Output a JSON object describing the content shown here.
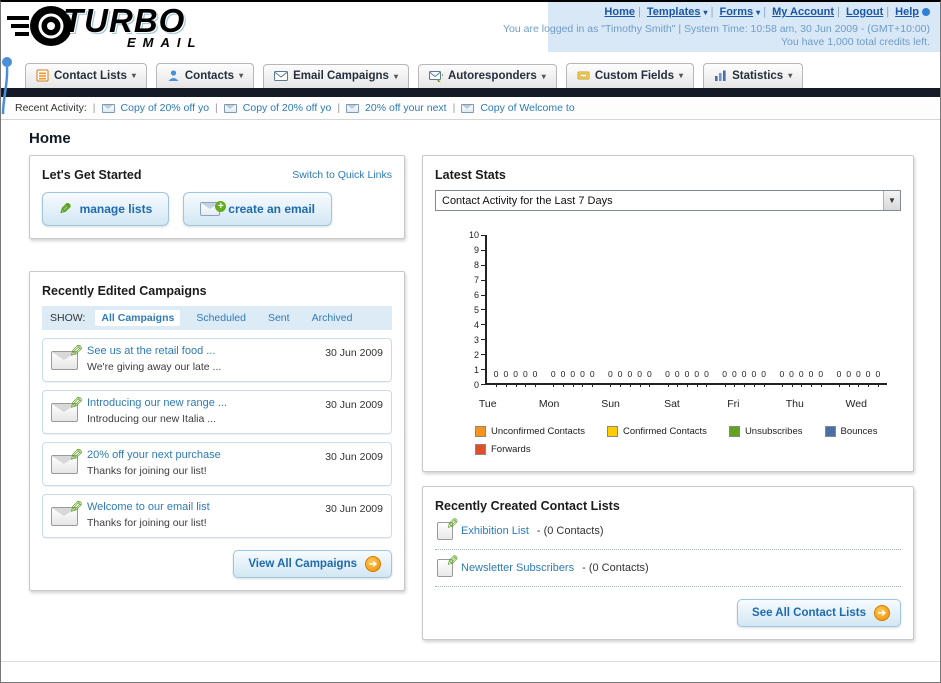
{
  "colors": {
    "link_blue": "#1a56a8",
    "dark_bar": "#141b27",
    "accent_orange": "#f29005",
    "button_text": "#1e6bb0"
  },
  "header": {
    "logo_top": "TURBO",
    "logo_bottom": "EMAIL",
    "nav_links": [
      {
        "label": "Home"
      },
      {
        "label": "Templates"
      },
      {
        "label": "Forms"
      },
      {
        "label": "My Account"
      },
      {
        "label": "Logout"
      },
      {
        "label": "Help"
      }
    ],
    "login_info": "You are logged in as \"Timothy Smith\" | System Time: 10:58 am, 30 Jun 2009 - (GMT+10:00)",
    "credits_info": "You have 1,000 total credits left."
  },
  "nav_tabs": [
    {
      "label": "Contact Lists"
    },
    {
      "label": "Contacts"
    },
    {
      "label": "Email Campaigns"
    },
    {
      "label": "Autoresponders"
    },
    {
      "label": "Custom Fields"
    },
    {
      "label": "Statistics"
    }
  ],
  "recent_activity": {
    "label": "Recent Activity:",
    "items": [
      "Copy of 20% off yo",
      "Copy of 20% off yo",
      "20% off your next",
      "Copy of Welcome to"
    ]
  },
  "page_title": "Home",
  "get_started": {
    "title": "Let's Get Started",
    "switch_link": "Switch to Quick Links",
    "manage_lists_label": "manage lists",
    "create_email_label": "create an email"
  },
  "campaigns": {
    "title": "Recently Edited Campaigns",
    "show_label": "SHOW:",
    "filters": [
      {
        "label": "All Campaigns"
      },
      {
        "label": "Scheduled"
      },
      {
        "label": "Sent"
      },
      {
        "label": "Archived"
      }
    ],
    "items": [
      {
        "title": "See us at the retail food ...",
        "subtitle": "We're giving away our late ...",
        "date": "30 Jun 2009"
      },
      {
        "title": "Introducing our new range ...",
        "subtitle": "Introducing our new Italia ...",
        "date": "30 Jun 2009"
      },
      {
        "title": "20% off your next purchase",
        "subtitle": "Thanks for joining our list!",
        "date": "30 Jun 2009"
      },
      {
        "title": "Welcome to our email list",
        "subtitle": "Thanks for joining our list!",
        "date": "30 Jun 2009"
      }
    ],
    "view_all_label": "View All Campaigns"
  },
  "latest_stats": {
    "title": "Latest Stats",
    "dropdown_value": "Contact Activity for the Last 7 Days",
    "chart_data": {
      "type": "bar",
      "categories": [
        "Tue",
        "Mon",
        "Sun",
        "Sat",
        "Fri",
        "Thu",
        "Wed"
      ],
      "series": [
        {
          "name": "Unconfirmed Contacts",
          "values": [
            0,
            0,
            0,
            0,
            0,
            0,
            0
          ]
        },
        {
          "name": "Confirmed Contacts",
          "values": [
            0,
            0,
            0,
            0,
            0,
            0,
            0
          ]
        },
        {
          "name": "Unsubscribes",
          "values": [
            0,
            0,
            0,
            0,
            0,
            0,
            0
          ]
        },
        {
          "name": "Bounces",
          "values": [
            0,
            0,
            0,
            0,
            0,
            0,
            0
          ]
        },
        {
          "name": "Forwards",
          "values": [
            0,
            0,
            0,
            0,
            0,
            0,
            0
          ]
        }
      ],
      "legend": [
        {
          "label": "Unconfirmed Contacts",
          "color": "#f7941d"
        },
        {
          "label": "Confirmed Contacts",
          "color": "#ffcc00"
        },
        {
          "label": "Unsubscribes",
          "color": "#62a31f"
        },
        {
          "label": "Bounces",
          "color": "#4a6fa5"
        },
        {
          "label": "Forwards",
          "color": "#e04e2a"
        }
      ],
      "title": "Contact Activity for the Last 7 Days",
      "xlabel": "",
      "ylabel": "",
      "ylim": [
        0,
        10
      ],
      "grid": false,
      "legend_position": "bottom"
    }
  },
  "contact_lists": {
    "title": "Recently Created Contact Lists",
    "items": [
      {
        "name": "Exhibition List",
        "count": "- (0 Contacts)"
      },
      {
        "name": "Newsletter Subscribers",
        "count": "- (0 Contacts)"
      }
    ],
    "see_all_label": "See All Contact Lists"
  }
}
